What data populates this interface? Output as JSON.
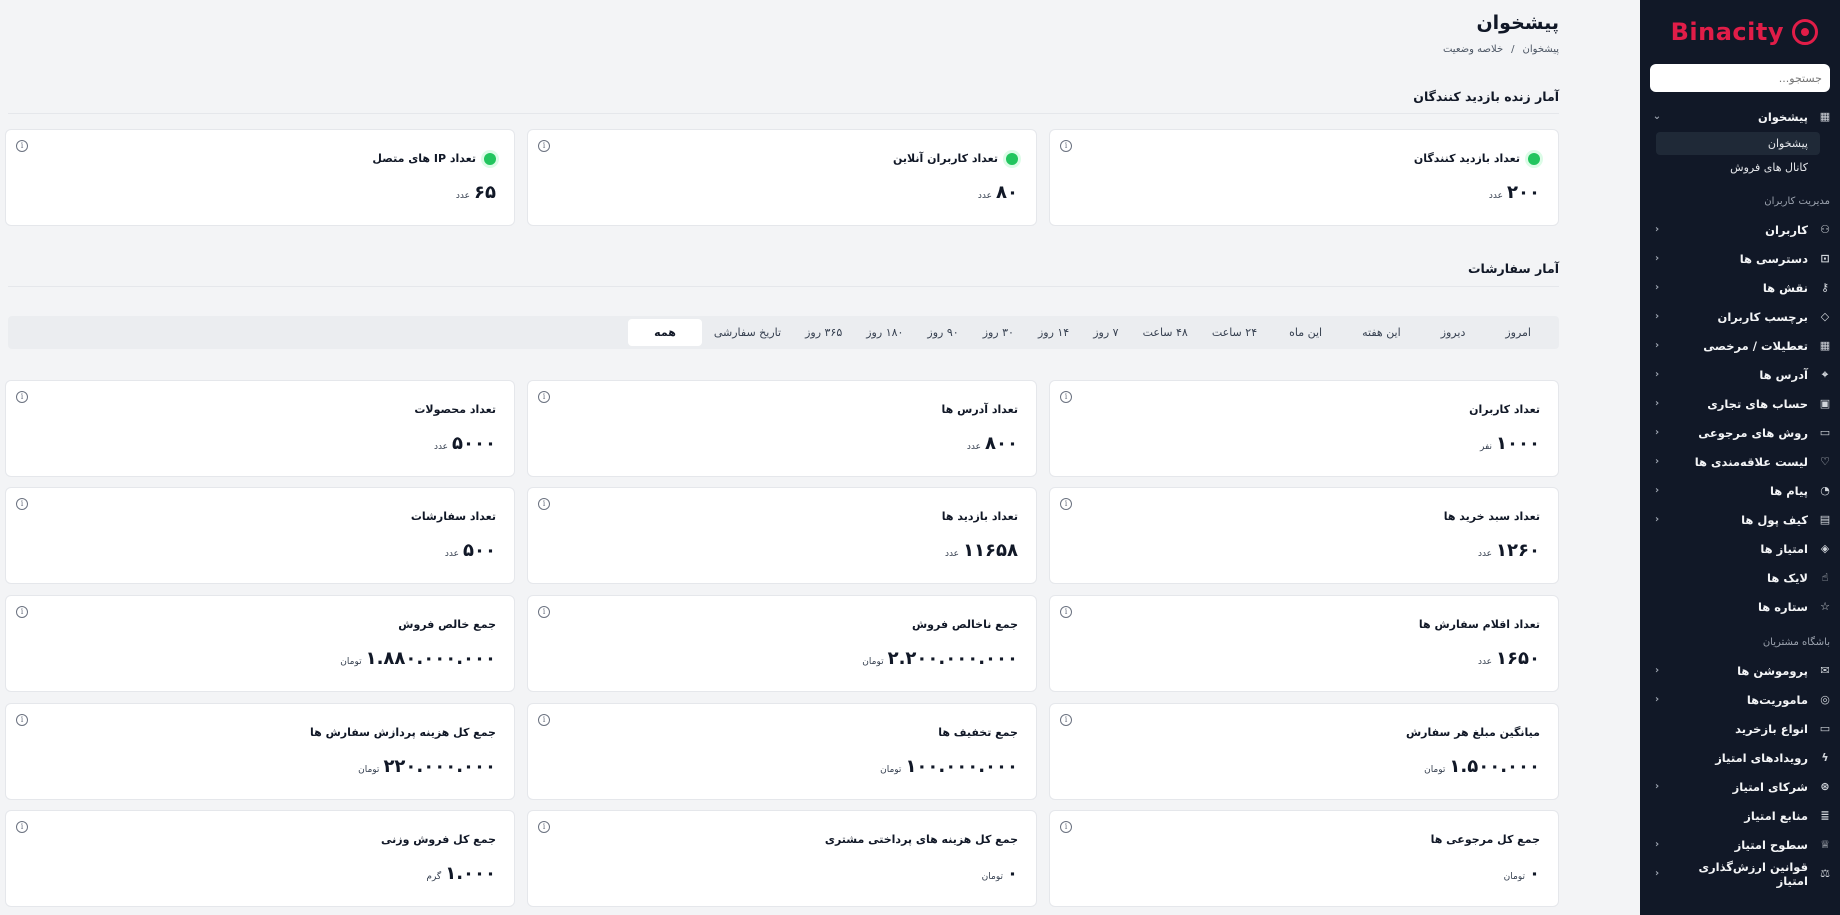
{
  "sidebar": {
    "logo": "Binacity",
    "search_placeholder": "جستجو...",
    "dashboard": {
      "label": "پیشخوان",
      "sub": [
        "پیشخوان",
        "کانال های فروش"
      ]
    },
    "section_users": "مدیریت کاربران",
    "users_items": [
      {
        "label": "کاربران",
        "icon": "users-icon",
        "chev": true
      },
      {
        "label": "دسترسی ها",
        "icon": "lock-icon",
        "chev": true
      },
      {
        "label": "نقش ها",
        "icon": "key-icon",
        "chev": true
      },
      {
        "label": "برچسب کاربران",
        "icon": "tag-icon",
        "chev": true
      },
      {
        "label": "تعطیلات / مرخصی",
        "icon": "calendar-icon",
        "chev": true
      },
      {
        "label": "آدرس ها",
        "icon": "location-pin-icon",
        "chev": true
      },
      {
        "label": "حساب های تجاری",
        "icon": "briefcase-icon",
        "chev": true
      },
      {
        "label": "روش های مرجوعی",
        "icon": "card-icon",
        "chev": true
      },
      {
        "label": "لیست علاقه‌مندی ها",
        "icon": "heart-icon",
        "chev": true
      },
      {
        "label": "پیام ها",
        "icon": "bell-icon",
        "chev": true
      },
      {
        "label": "کیف پول ها",
        "icon": "wallet-icon",
        "chev": true
      },
      {
        "label": "امتیاز ها",
        "icon": "points-icon",
        "chev": false
      },
      {
        "label": "لایک ها",
        "icon": "thumbs-up-icon",
        "chev": false
      },
      {
        "label": "ستاره ها",
        "icon": "star-icon",
        "chev": false
      }
    ],
    "section_club": "باشگاه مشتریان",
    "club_items": [
      {
        "label": "پروموشن ها",
        "icon": "mail-icon",
        "chev": true
      },
      {
        "label": "ماموریت‌ها",
        "icon": "target-icon",
        "chev": true
      },
      {
        "label": "انواع بازخرید",
        "icon": "ticket-icon",
        "chev": false
      },
      {
        "label": "رویدادهای امتیاز",
        "icon": "bolt-icon",
        "chev": false
      },
      {
        "label": "شرکای امتیاز",
        "icon": "handshake-icon",
        "chev": true
      },
      {
        "label": "منابع امتیاز",
        "icon": "database-icon",
        "chev": false
      },
      {
        "label": "سطوح امتیاز",
        "icon": "crown-icon",
        "chev": true
      },
      {
        "label": "قوانین ارزش‌گذاری امتیاز",
        "icon": "scale-icon",
        "chev": true
      }
    ]
  },
  "header": {
    "title": "پیشخوان",
    "breadcrumb": [
      "پیشخوان",
      "/",
      "خلاصه وضعیت"
    ]
  },
  "live": {
    "title": "آمار زنده بازدید کنندگان",
    "cards": [
      {
        "title": "تعداد بازدید کنندگان",
        "value": "۲۰۰",
        "unit": "عدد"
      },
      {
        "title": "تعداد کاربران آنلاین",
        "value": "۸۰",
        "unit": "عدد"
      },
      {
        "title": "تعداد IP های متصل",
        "value": "۶۵",
        "unit": "عدد"
      }
    ]
  },
  "orders": {
    "title": "آمار سفارشات",
    "filters": [
      "امروز",
      "دیروز",
      "این هفته",
      "این ماه",
      "۲۴ ساعت",
      "۴۸ ساعت",
      "۷ روز",
      "۱۴ روز",
      "۳۰ روز",
      "۹۰ روز",
      "۱۸۰ روز",
      "۳۶۵ روز",
      "تاریخ سفارشی",
      "همه"
    ],
    "active_filter": "همه",
    "rows": [
      [
        {
          "title": "تعداد کاربران",
          "value": "۱۰۰۰",
          "unit": "نفر"
        },
        {
          "title": "تعداد آدرس ها",
          "value": "۸۰۰",
          "unit": "عدد"
        },
        {
          "title": "تعداد محصولات",
          "value": "۵۰۰۰",
          "unit": "عدد"
        }
      ],
      [
        {
          "title": "تعداد سبد خرید ها",
          "value": "۱۲۶۰",
          "unit": "عدد"
        },
        {
          "title": "تعداد بازدید ها",
          "value": "۱۱۶۵۸",
          "unit": "عدد"
        },
        {
          "title": "تعداد سفارشات",
          "value": "۵۰۰",
          "unit": "عدد"
        }
      ],
      [
        {
          "title": "تعداد اقلام سفارش ها",
          "value": "۱۶۵۰",
          "unit": "عدد"
        },
        {
          "title": "جمع ناخالص فروش",
          "value": "۲.۲۰۰.۰۰۰.۰۰۰",
          "unit": "تومان"
        },
        {
          "title": "جمع خالص فروش",
          "value": "۱.۸۸۰.۰۰۰.۰۰۰",
          "unit": "تومان"
        }
      ],
      [
        {
          "title": "میانگین مبلغ هر سفارش",
          "value": "۱.۵۰۰.۰۰۰",
          "unit": "تومان"
        },
        {
          "title": "جمع تخفیف ها",
          "value": "۱۰۰.۰۰۰.۰۰۰",
          "unit": "تومان"
        },
        {
          "title": "جمع کل هزینه پردازش سفارش ها",
          "value": "۲۲۰.۰۰۰.۰۰۰",
          "unit": "تومان"
        }
      ],
      [
        {
          "title": "جمع کل مرجوعی ها",
          "value": "۰",
          "unit": "تومان"
        },
        {
          "title": "جمع کل هزینه های پرداختی مشتری",
          "value": "۰",
          "unit": "تومان"
        },
        {
          "title": "جمع کل فروش وزنی",
          "value": "۱.۰۰۰",
          "unit": "گرم"
        }
      ]
    ]
  }
}
